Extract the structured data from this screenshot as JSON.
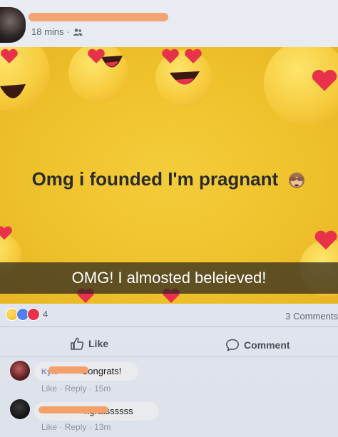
{
  "post": {
    "author_name": "·· ··· ······ ···",
    "time": "18 mins",
    "separator": "·"
  },
  "image": {
    "headline": "Omg i founded I'm pragnant",
    "caption": "OMG! I almosted beleieved!"
  },
  "reactions": {
    "count": "4",
    "comments_label": "3 Comments"
  },
  "actions": {
    "like_label": "Like",
    "comment_label": "Comment"
  },
  "comments": [
    {
      "author": "Kyle ······",
      "text": "Congrats!",
      "like": "Like",
      "reply": "Reply",
      "sep": "·",
      "time": "15m"
    },
    {
      "author": "······ ········",
      "text": "ngratssssss",
      "like": "Like",
      "reply": "Reply",
      "sep": "·",
      "time": "13m"
    }
  ],
  "colors": {
    "redaction": "#f3a06b",
    "emoji_yellow": "#f6c93a",
    "heart_red": "#e8324a",
    "like_blue": "#4f81f0"
  }
}
